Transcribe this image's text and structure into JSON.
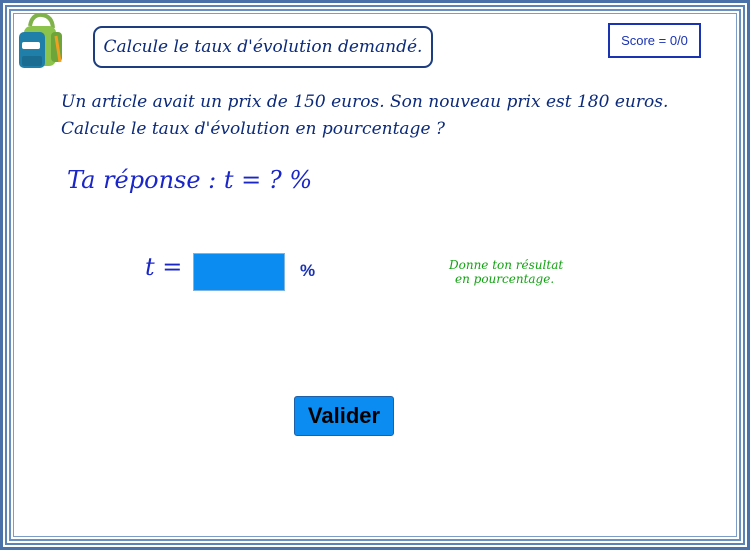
{
  "header": {
    "title": "Calcule le taux d'évolution demandé.",
    "score": "Score = 0/0",
    "logo_icon": "backpack-icon"
  },
  "question": {
    "line1": "Un article avait un prix de 150 euros. Son nouveau prix est 180 euros.",
    "line2": "Calcule le taux d'évolution en pourcentage ?"
  },
  "answer": {
    "prompt": "Ta réponse :  t = ? %",
    "t_label": "t =",
    "input_value": "",
    "unit": "%"
  },
  "hint": {
    "line1": "Donne ton résultat",
    "line2": "en pourcentage."
  },
  "actions": {
    "validate_label": "Valider"
  },
  "colors": {
    "frame": "#4a72a8",
    "input_bg": "#0a8cf0",
    "button_bg": "#0a8cf0",
    "hint": "#12a312",
    "math_text": "#1a26c8"
  }
}
